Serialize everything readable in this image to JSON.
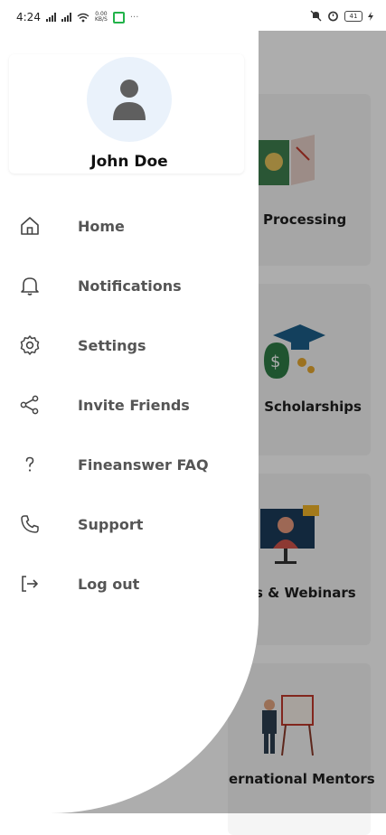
{
  "status_bar": {
    "time": "4:24",
    "speed_value": "0.00",
    "speed_unit": "KB/S",
    "battery": "41"
  },
  "background": {
    "cards": [
      {
        "label": "Processing"
      },
      {
        "label": ": Scholarships"
      },
      {
        "label": "s & Webinars"
      },
      {
        "label": "ernational Mentors"
      }
    ]
  },
  "drawer": {
    "profile": {
      "name": "John Doe"
    },
    "menu": [
      {
        "label": "Home",
        "icon": "home-icon"
      },
      {
        "label": "Notifications",
        "icon": "bell-icon"
      },
      {
        "label": "Settings",
        "icon": "gear-icon"
      },
      {
        "label": "Invite Friends",
        "icon": "share-icon"
      },
      {
        "label": "Fineanswer FAQ",
        "icon": "question-icon"
      },
      {
        "label": "Support",
        "icon": "phone-icon"
      },
      {
        "label": "Log out",
        "icon": "logout-icon"
      }
    ]
  }
}
